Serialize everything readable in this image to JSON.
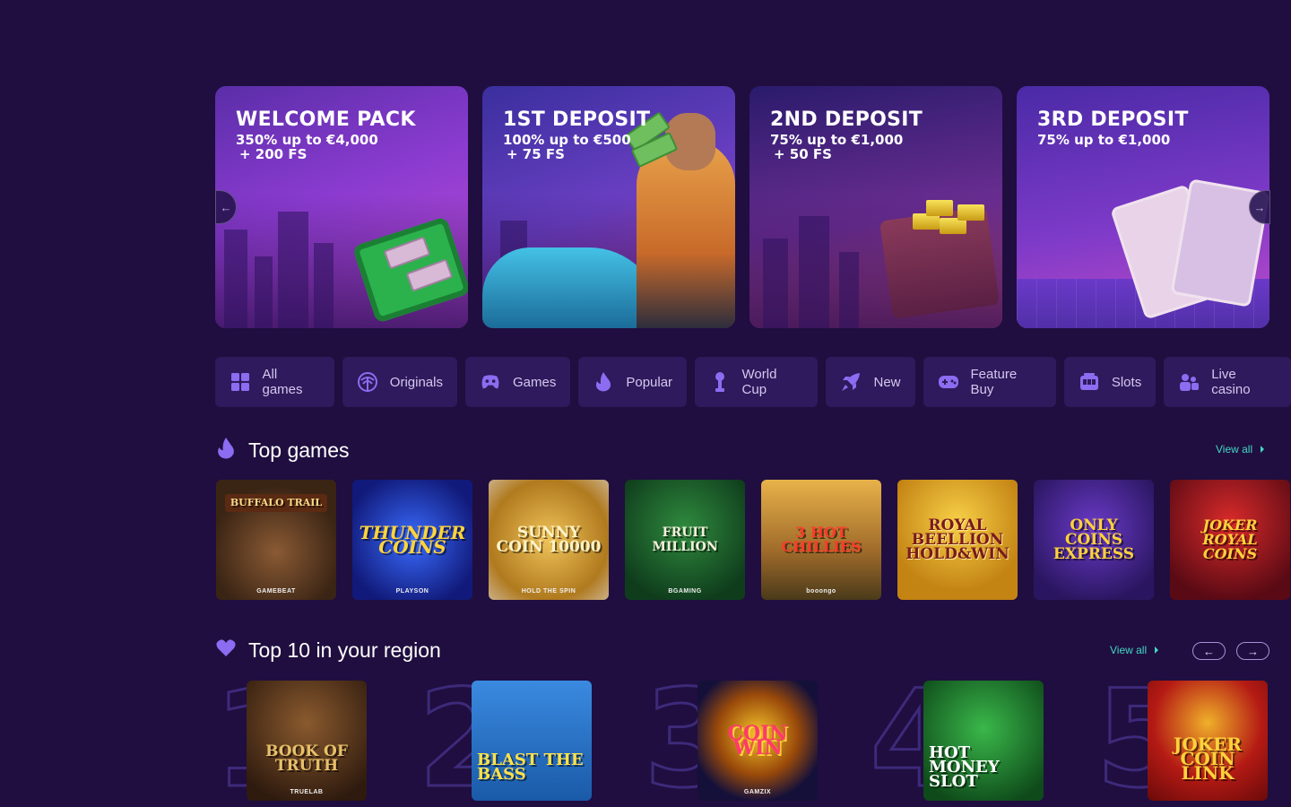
{
  "promos": [
    {
      "title": "WELCOME PACK",
      "line1": "350% up to €4,000",
      "line2": "+ 200 FS"
    },
    {
      "title": "1ST DEPOSIT",
      "line1": "100% up to €500",
      "line2": "+ 75 FS"
    },
    {
      "title": "2ND DEPOSIT",
      "line1": "75% up to €1,000",
      "line2": "+ 50 FS"
    },
    {
      "title": "3RD DEPOSIT",
      "line1": "75% up to €1,000",
      "line2": ""
    }
  ],
  "tabs": [
    {
      "label": "All games",
      "icon": "grid-icon"
    },
    {
      "label": "Originals",
      "icon": "palm-icon"
    },
    {
      "label": "Games",
      "icon": "gamepad-icon"
    },
    {
      "label": "Popular",
      "icon": "flame-icon"
    },
    {
      "label": "World Cup",
      "icon": "trophy-icon"
    },
    {
      "label": "New",
      "icon": "rocket-icon"
    },
    {
      "label": "Feature Buy",
      "icon": "controller-icon"
    },
    {
      "label": "Slots",
      "icon": "slot-machine-icon"
    },
    {
      "label": "Live casino",
      "icon": "users-icon"
    }
  ],
  "top_games": {
    "title": "Top games",
    "view_all": "View all",
    "items": [
      {
        "name": "BUFFALO TRAIL",
        "provider": "GAMEBEAT",
        "bg": "#5b3a24"
      },
      {
        "name": "THUNDER COINS",
        "provider": "PLAYSON",
        "bg": "#1d2fb0"
      },
      {
        "name": "SUNNY COIN 10000",
        "provider": "HOLD THE SPIN",
        "bg": "#c98a2a"
      },
      {
        "name": "FRUIT MILLION",
        "provider": "BGAMING",
        "bg": "#175a2c"
      },
      {
        "name": "3 HOT CHILLIES",
        "provider": "booongo",
        "bg": "#7c6a2d"
      },
      {
        "name": "ROYAL BEELLION HOLD&WIN",
        "provider": "",
        "bg": "#c78d1a"
      },
      {
        "name": "ONLY COINS EXPRESS",
        "provider": "",
        "bg": "#4a2a8a"
      },
      {
        "name": "JOKER ROYAL COINS",
        "provider": "",
        "bg": "#9a1020"
      }
    ]
  },
  "top10": {
    "title": "Top 10 in your region",
    "view_all": "View all",
    "items": [
      {
        "rank": "1",
        "name": "BOOK OF TRUTH",
        "provider": "TRUELAB",
        "bg": "#4a3020"
      },
      {
        "rank": "2",
        "name": "BLAST THE BASS",
        "provider": "",
        "bg": "#2a7ac8"
      },
      {
        "rank": "3",
        "name": "COIN WIN",
        "provider": "GAMZIX",
        "bg": "#1a1240"
      },
      {
        "rank": "4",
        "name": "HOT MONEY SLOT",
        "provider": "",
        "bg": "#1f7a2a"
      },
      {
        "rank": "5",
        "name": "JOKER COIN LINK",
        "provider": "",
        "bg": "#a01414"
      }
    ]
  },
  "colors": {
    "background": "#1f0e3f",
    "tab_bg": "#2e1a5c",
    "accent": "#45d6c6",
    "icon_purple": "#8c6cf0"
  }
}
